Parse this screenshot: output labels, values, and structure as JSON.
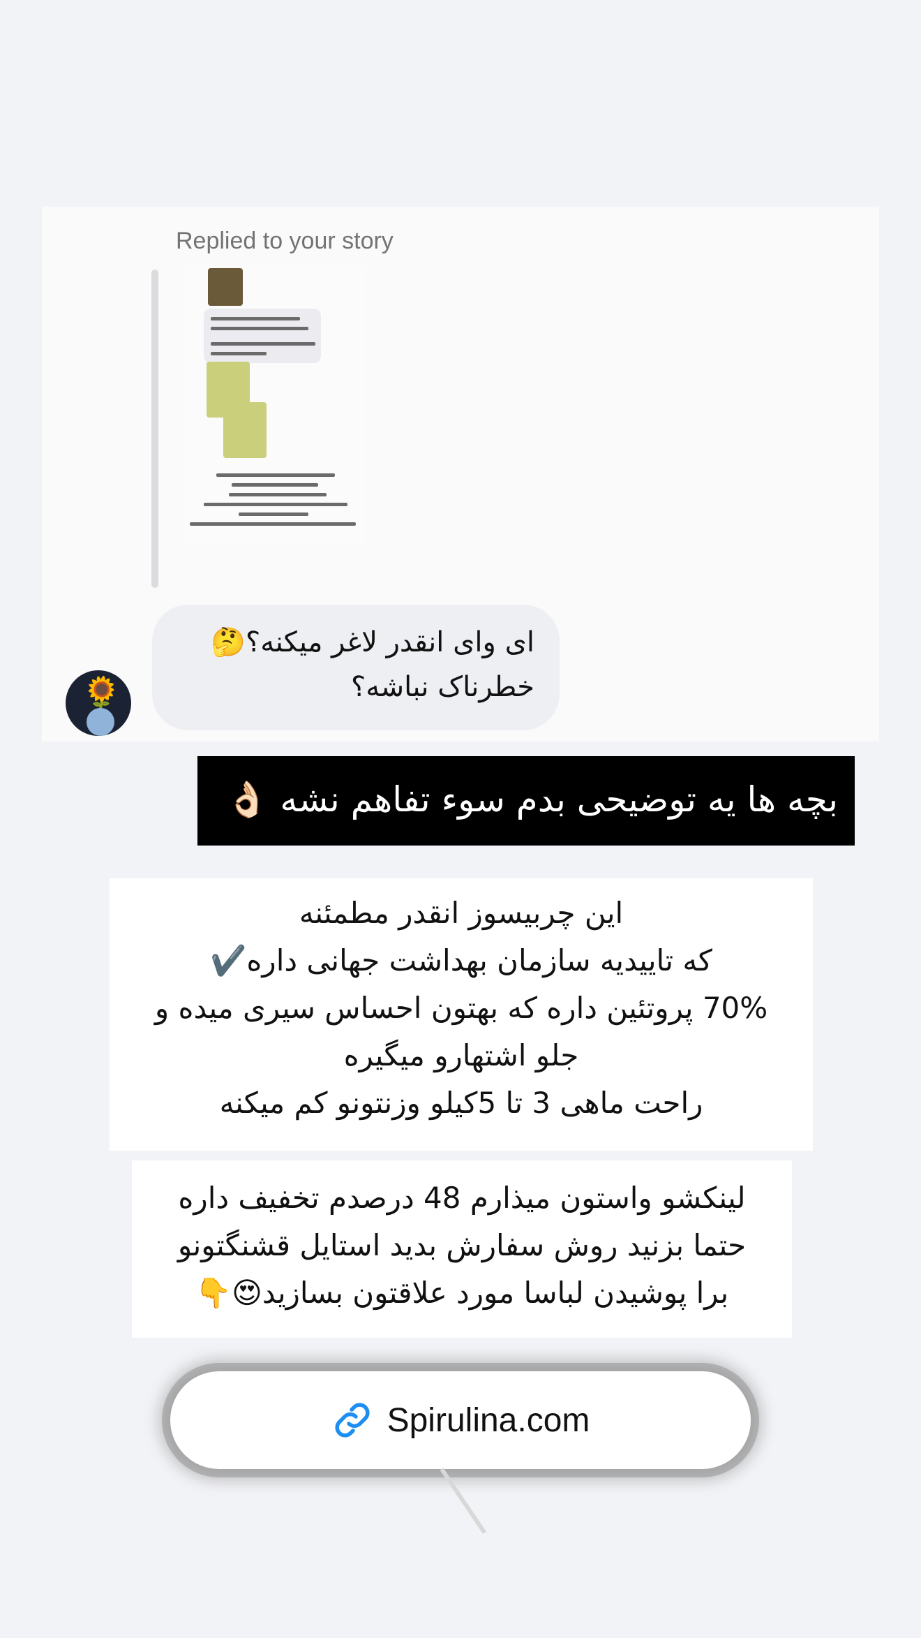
{
  "dm": {
    "replied_label": "Replied to your story",
    "message_text": "ای وای انقدر لاغر میکنه؟🤔 خطرناک نباشه؟",
    "avatar_icon": "sunflower-avatar"
  },
  "banner": {
    "text": "بچه ها یه توضیحی بدم سوء تفاهم نشه 👌🏻"
  },
  "info_block": {
    "line1": "این چربیسوز انقدر مطمئنه",
    "line2": "که تاییدیه سازمان بهداشت جهانی داره✔️",
    "line3": "70% پروتئین داره که بهتون احساس سیری میده و",
    "line4": "جلو اشتهارو میگیره",
    "line5": "راحت ماهی 3 تا 5کیلو  وزنتونو کم میکنه"
  },
  "promo_block": {
    "line1": "لینکشو واستون میذارم 48 درصدم تخفیف داره",
    "line2": "حتما بزنید روش سفارش بدید  استایل قشنگتونو",
    "line3": "برا پوشیدن لباسا مورد علاقتون بسازید😍👇"
  },
  "link_sticker": {
    "icon": "link-icon",
    "label": "Spirulina.com",
    "accent": "#1f8ef1"
  }
}
